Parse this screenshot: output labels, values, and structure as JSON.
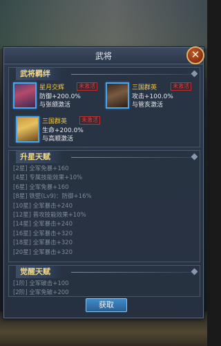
{
  "panel": {
    "title": "武将"
  },
  "bonds": {
    "header": "武将羁绊",
    "items": [
      {
        "name": "星月交辉",
        "status": "未激活",
        "effect": "防御+200.0%",
        "condition": "与张颌激活",
        "portrait": "general-portrait-female"
      },
      {
        "name": "三国群英",
        "status": "未激活",
        "effect": "攻击+100.0%",
        "condition": "与管亥激活",
        "portrait": "general-portrait-bearded"
      },
      {
        "name": "三国群英",
        "status": "未激活",
        "effect": "生命+200.0%",
        "condition": "与高顺激活",
        "portrait": "general-portrait-golden"
      }
    ]
  },
  "upgrade_talents": {
    "header": "升星天赋",
    "rows": [
      "[2星] 全军免暴+160",
      "[4星] 专属技能效果+10%",
      "[6星] 全军免暴+160",
      "[8星] 铁壁(Lv9)：防御+16%",
      "[10星] 全军暴击+240",
      "[12星] 普攻技能效果+10%",
      "[14星] 全军暴击+240",
      "[16星] 全军暴击+320",
      "[18星] 全军暴击+320",
      "[20星] 全军暴击+320"
    ]
  },
  "awaken_talents": {
    "header": "觉醒天赋",
    "rows": [
      "[1阶] 全军破击+100",
      "[2阶] 全军免破+200"
    ]
  },
  "actions": {
    "get_label": "获取"
  },
  "colors": {
    "accent_gold": "#f0c850",
    "inactive_red": "#e04040",
    "button_blue": "#3f8bc8"
  }
}
